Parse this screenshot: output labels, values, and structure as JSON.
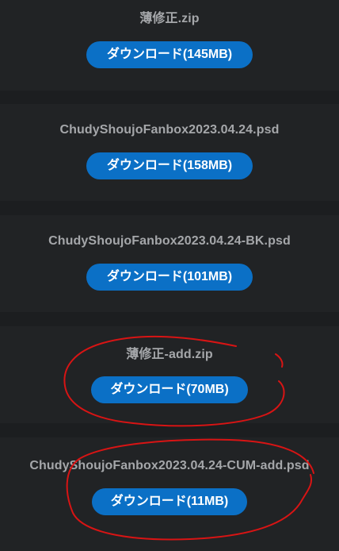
{
  "files": [
    {
      "name": "薄修正.zip",
      "button_label": "ダウンロード(145MB)"
    },
    {
      "name": "ChudyShoujoFanbox2023.04.24.psd",
      "button_label": "ダウンロード(158MB)"
    },
    {
      "name": "ChudyShoujoFanbox2023.04.24-BK.psd",
      "button_label": "ダウンロード(101MB)"
    },
    {
      "name": "薄修正-add.zip",
      "button_label": "ダウンロード(70MB)"
    },
    {
      "name": "ChudyShoujoFanbox2023.04.24-CUM-add.psd",
      "button_label": "ダウンロード(11MB)"
    }
  ],
  "colors": {
    "page_background": "#1c1e20",
    "card_background": "#212325",
    "button_background": "#0b70c6",
    "annotation_stroke": "#d81414"
  }
}
